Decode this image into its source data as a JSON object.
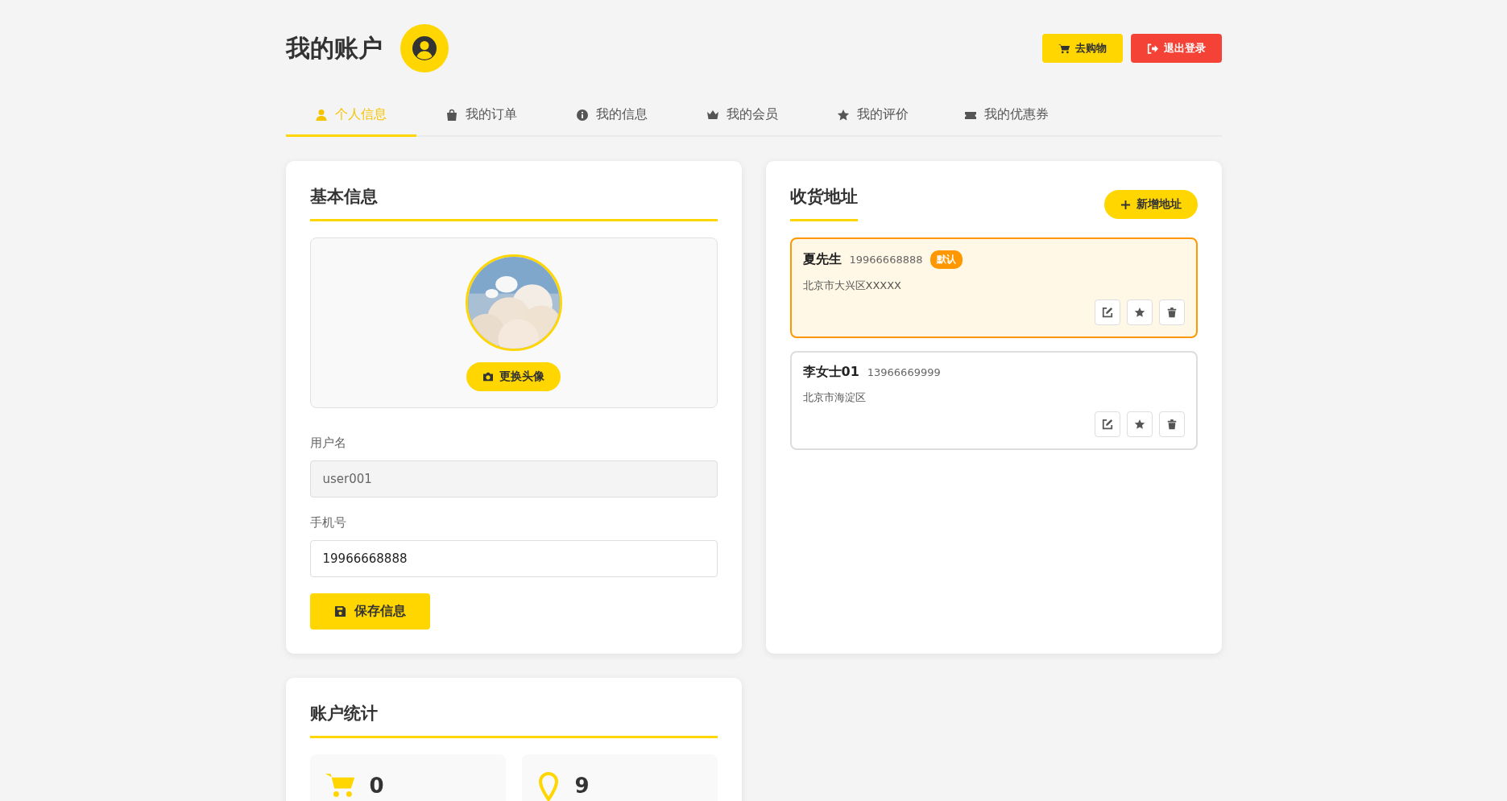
{
  "header": {
    "title": "我的账户",
    "buttons": [
      {
        "kind": "cart",
        "label": "去购物"
      },
      {
        "kind": "logout",
        "label": "退出登录"
      }
    ]
  },
  "tabs": [
    {
      "label": "个人信息",
      "selected": true
    },
    {
      "label": "我的订单",
      "selected": false
    },
    {
      "label": "我的信息",
      "selected": false
    },
    {
      "label": "我的会员",
      "selected": false
    },
    {
      "label": "我的评价",
      "selected": false
    },
    {
      "label": "我的优惠券",
      "selected": false
    }
  ],
  "basic_info": {
    "title": "基本信息",
    "avatar_button": "更换头像",
    "fields": [
      {
        "label": "用户名",
        "value": "user001",
        "disabled": true
      },
      {
        "label": "手机号",
        "value": "19966668888",
        "disabled": false
      }
    ],
    "save_button": "保存信息"
  },
  "addresses": {
    "title": "收货地址",
    "add_button": "新增地址",
    "items": [
      {
        "name": "夏先生",
        "phone": "19966668888",
        "badge": "默认",
        "address": "北京市大兴区XXXXX",
        "default": true
      },
      {
        "name": "李女士01",
        "phone": "13966669999",
        "address": "北京市海淀区",
        "default": false
      }
    ]
  },
  "stats": {
    "title": "账户统计",
    "items": [
      {
        "value": "0"
      },
      {
        "value": "9"
      }
    ]
  }
}
